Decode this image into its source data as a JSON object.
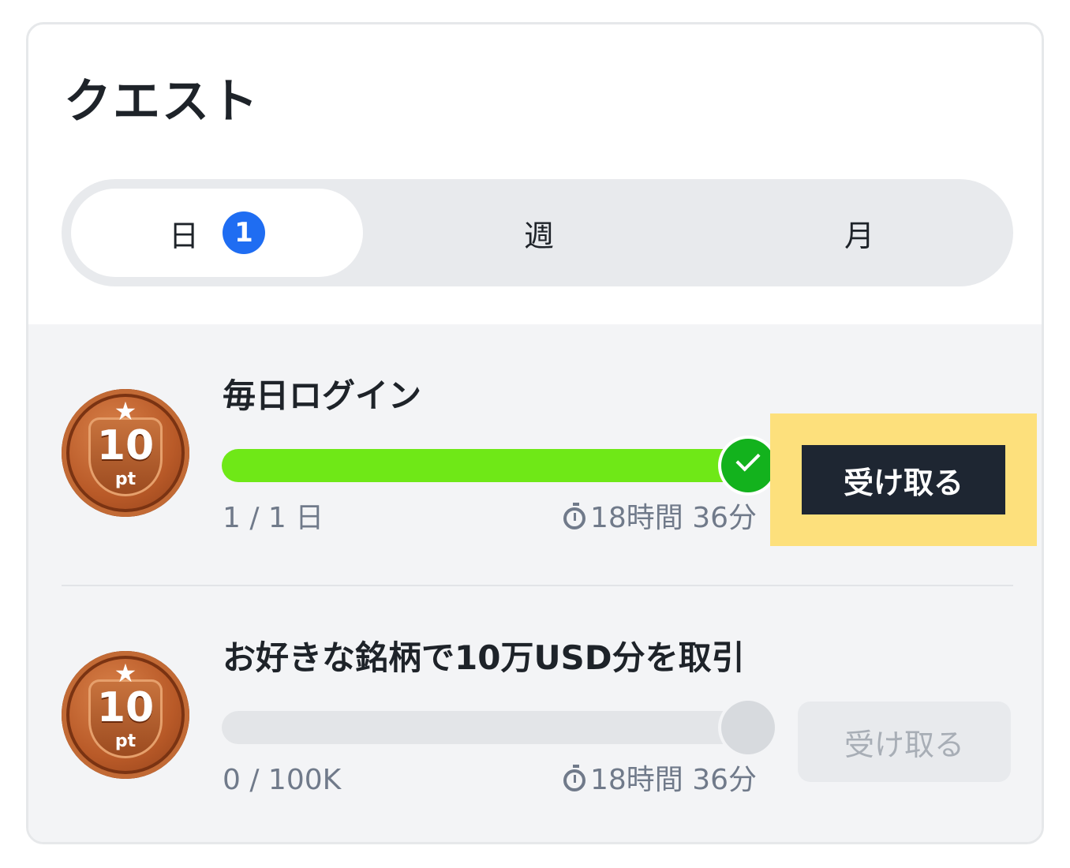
{
  "header": {
    "title": "クエスト"
  },
  "tabs": [
    {
      "label": "日",
      "badge": "1",
      "active": true
    },
    {
      "label": "週"
    },
    {
      "label": "月"
    }
  ],
  "quests": [
    {
      "reward_amount": "10",
      "reward_unit": "pt",
      "title": "毎日ログイン",
      "progress_text": "1 / 1 日",
      "progress_fraction": 1.0,
      "timer": "18時間 36分",
      "claim_label": "受け取る",
      "claimable": true
    },
    {
      "reward_amount": "10",
      "reward_unit": "pt",
      "title": "お好きな銘柄で10万USD分を取引",
      "progress_text": "0 / 100K",
      "progress_fraction": 0.0,
      "timer": "18時間 36分",
      "claim_label": "受け取る",
      "claimable": false
    }
  ],
  "colors": {
    "accent_badge": "#1f6df2",
    "progress_fill": "#6fe817",
    "done_check": "#13b21d",
    "highlight": "#fde07c",
    "claim_button": "#1e2632"
  },
  "icons": {
    "star": "star-icon",
    "check": "check-icon",
    "timer": "timer-icon"
  }
}
